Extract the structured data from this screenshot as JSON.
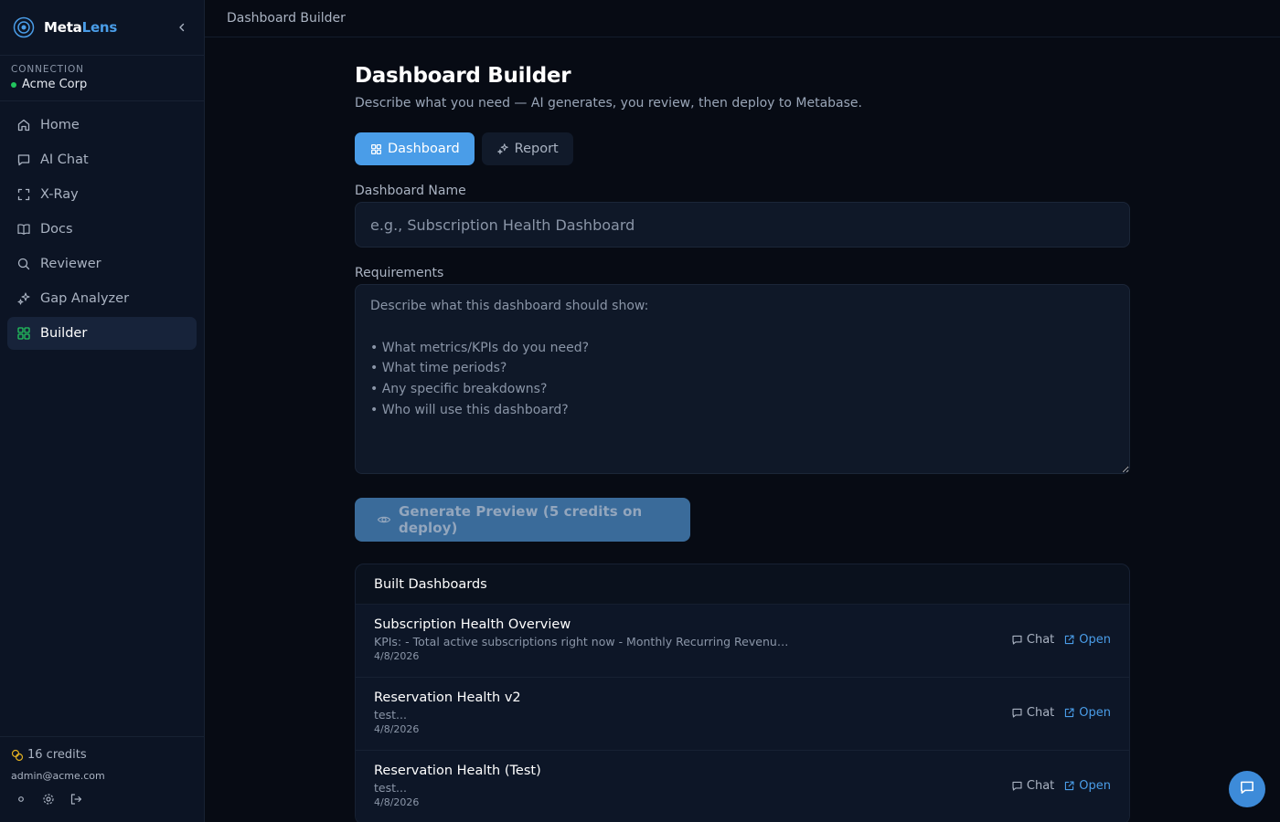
{
  "app": {
    "brand_part1": "Meta",
    "brand_part2": "Lens"
  },
  "connection": {
    "label": "CONNECTION",
    "name": "Acme Corp",
    "status_color": "#22c55e"
  },
  "sidebar": {
    "items": [
      {
        "label": "Home",
        "icon": "home-icon",
        "active": false
      },
      {
        "label": "AI Chat",
        "icon": "chat-icon",
        "active": false
      },
      {
        "label": "X-Ray",
        "icon": "scan-icon",
        "active": false
      },
      {
        "label": "Docs",
        "icon": "book-icon",
        "active": false
      },
      {
        "label": "Reviewer",
        "icon": "search-icon",
        "active": false
      },
      {
        "label": "Gap Analyzer",
        "icon": "sparkles-icon",
        "active": false
      },
      {
        "label": "Builder",
        "icon": "grid-icon",
        "active": true
      }
    ]
  },
  "footer": {
    "credits": "16 credits",
    "email": "admin@acme.com"
  },
  "topbar": {
    "breadcrumb": "Dashboard Builder"
  },
  "main": {
    "title": "Dashboard Builder",
    "subtitle": "Describe what you need — AI generates, you review, then deploy to Metabase.",
    "tabs": [
      {
        "label": "Dashboard",
        "icon": "grid-icon",
        "active": true
      },
      {
        "label": "Report",
        "icon": "sparkles-icon",
        "active": false
      }
    ],
    "name_label": "Dashboard Name",
    "name_placeholder": "e.g., Subscription Health Dashboard",
    "requirements_label": "Requirements",
    "requirements_placeholder": "Describe what this dashboard should show:\n\n• What metrics/KPIs do you need?\n• What time periods?\n• Any specific breakdowns?\n• Who will use this dashboard?",
    "generate_label": "Generate Preview (5 credits on deploy)"
  },
  "built": {
    "title": "Built Dashboards",
    "chat_label": "Chat",
    "open_label": "Open",
    "rows": [
      {
        "title": "Subscription Health Overview",
        "desc": "KPIs: - Total active subscriptions right now - Monthly Recurring Revenue (M...",
        "date": "4/8/2026"
      },
      {
        "title": "Reservation Health v2",
        "desc": "test...",
        "date": "4/8/2026"
      },
      {
        "title": "Reservation Health (Test)",
        "desc": "test...",
        "date": "4/8/2026"
      }
    ]
  },
  "colors": {
    "accent": "#4a9de8",
    "background": "#070b14",
    "sidebar": "#0c1424"
  }
}
